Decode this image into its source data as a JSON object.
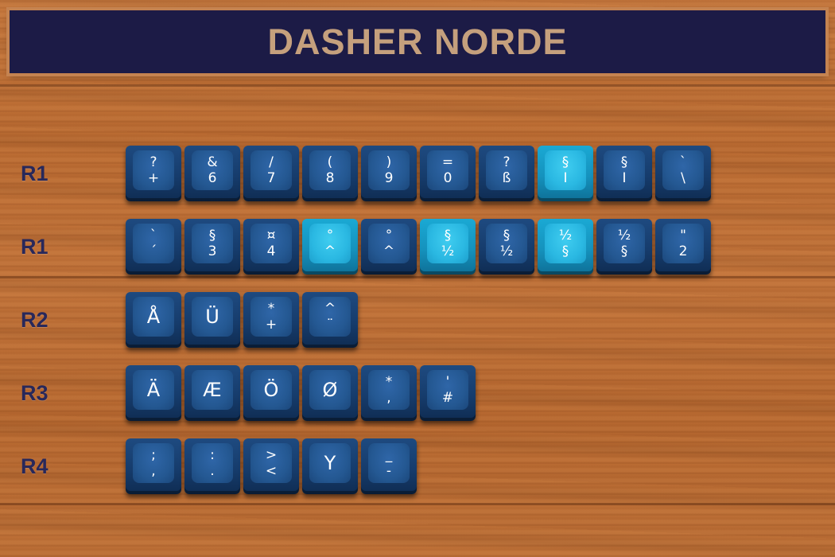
{
  "title": "DASHER NORDE",
  "rows": [
    {
      "label": "R1",
      "keys": [
        {
          "top": "?",
          "bottom": "+",
          "accent": false
        },
        {
          "top": "&",
          "bottom": "6",
          "accent": false
        },
        {
          "top": "/",
          "bottom": "7",
          "accent": false
        },
        {
          "top": "(",
          "bottom": "8",
          "accent": false
        },
        {
          "top": ")",
          "bottom": "9",
          "accent": false
        },
        {
          "top": "=",
          "bottom": "0",
          "accent": false
        },
        {
          "top": "?",
          "bottom": "ß",
          "accent": false
        },
        {
          "top": "§",
          "bottom": "I",
          "accent": true
        },
        {
          "top": "§",
          "bottom": "I",
          "accent": false
        },
        {
          "top": "`",
          "bottom": "\\",
          "accent": false
        }
      ]
    },
    {
      "label": "R1",
      "keys": [
        {
          "top": "`",
          "bottom": "´",
          "accent": false
        },
        {
          "top": "§",
          "bottom": "3",
          "accent": false
        },
        {
          "top": "¤",
          "bottom": "4",
          "accent": false
        },
        {
          "top": "°",
          "bottom": "^",
          "accent": true
        },
        {
          "top": "°",
          "bottom": "^",
          "accent": false
        },
        {
          "top": "§",
          "bottom": "½",
          "accent": true
        },
        {
          "top": "§",
          "bottom": "½",
          "accent": false
        },
        {
          "top": "½",
          "bottom": "§",
          "accent": true
        },
        {
          "top": "½",
          "bottom": "§",
          "accent": false
        },
        {
          "top": "\"",
          "bottom": "2",
          "accent": false
        }
      ]
    },
    {
      "label": "R2",
      "keys": [
        {
          "main": "Å",
          "accent": false
        },
        {
          "main": "Ü",
          "accent": false
        },
        {
          "top": "*",
          "bottom": "+",
          "accent": false
        },
        {
          "top": "^",
          "bottom": "¨",
          "accent": false
        }
      ]
    },
    {
      "label": "R3",
      "keys": [
        {
          "main": "Ä",
          "accent": false
        },
        {
          "main": "Æ",
          "accent": false
        },
        {
          "main": "Ö",
          "accent": false
        },
        {
          "main": "Ø",
          "accent": false
        },
        {
          "top": "*",
          "bottom": ",",
          "accent": false
        },
        {
          "top": "'",
          "bottom": "#",
          "accent": false
        }
      ]
    },
    {
      "label": "R4",
      "keys": [
        {
          "top": ";",
          "bottom": ",",
          "accent": false
        },
        {
          "top": ":",
          "bottom": ".",
          "accent": false
        },
        {
          "top": ">",
          "bottom": "<",
          "accent": false
        },
        {
          "main": "Y",
          "accent": false
        },
        {
          "top": "_",
          "bottom": "-",
          "accent": false
        }
      ]
    }
  ]
}
